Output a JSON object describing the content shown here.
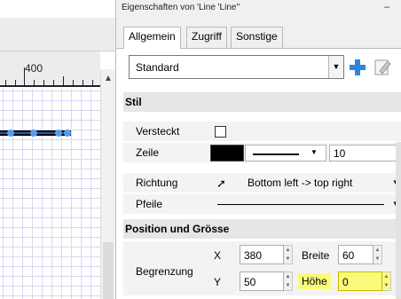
{
  "canvas": {
    "ruler_label": "400",
    "scroll_up_glyph": "▲"
  },
  "panel": {
    "title": "Eigenschaften von 'Line 'Line''",
    "minimize_glyph": "–",
    "tabs": [
      {
        "label": "Allgemein",
        "active": true
      },
      {
        "label": "Zugriff",
        "active": false
      },
      {
        "label": "Sonstige",
        "active": false
      }
    ],
    "preset": {
      "value": "Standard"
    },
    "icons": {
      "add": "plus-icon",
      "edit": "pencil-icon"
    },
    "sections": {
      "stil": "Stil",
      "position": "Position und Grösse"
    },
    "stil": {
      "versteckt_label": "Versteckt",
      "zeile_label": "Zeile",
      "zeile_color": "#000000",
      "zeile_width": "10",
      "richtung_label": "Richtung",
      "richtung_value": "Bottom left -> top right",
      "pfeile_label": "Pfeile"
    },
    "position": {
      "begrenzung_label": "Begrenzung",
      "x_label": "X",
      "x_value": "380",
      "y_label": "Y",
      "y_value": "50",
      "breite_label": "Breite",
      "breite_value": "60",
      "hoehe_label": "Höhe",
      "hoehe_value": "0"
    },
    "highlight_color": "#fbfb7b"
  }
}
